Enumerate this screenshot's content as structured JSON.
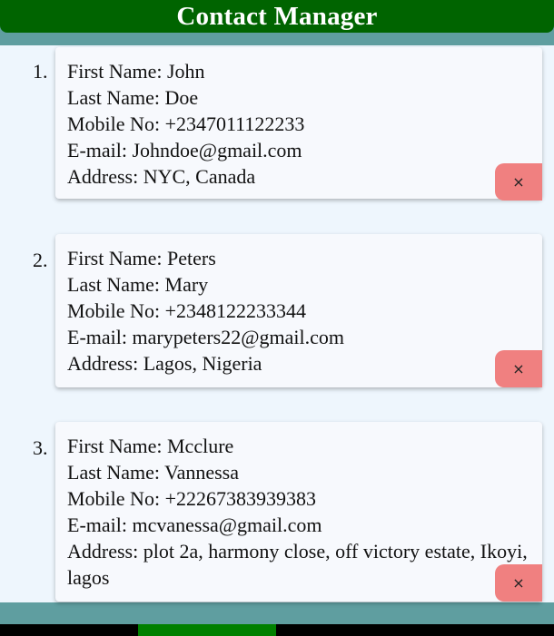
{
  "header": {
    "title": "Contact Manager"
  },
  "contacts": [
    {
      "number": "1.",
      "first_name_label": "First Name: ",
      "first_name": "John",
      "last_name_label": "Last Name: ",
      "last_name": "Doe",
      "mobile_label": "Mobile No: ",
      "mobile": "+2347011122233",
      "email_label": "E-mail: ",
      "email": "Johndoe@gmail.com",
      "address_label": "Address: ",
      "address": "NYC, Canada",
      "delete_label": "×"
    },
    {
      "number": "2.",
      "first_name_label": "First Name: ",
      "first_name": "Peters",
      "last_name_label": "Last Name: ",
      "last_name": "Mary",
      "mobile_label": "Mobile No: ",
      "mobile": "+2348122233344",
      "email_label": "E-mail: ",
      "email": "marypeters22@gmail.com",
      "address_label": "Address: ",
      "address": "Lagos, Nigeria",
      "delete_label": "×"
    },
    {
      "number": "3.",
      "first_name_label": "First Name: ",
      "first_name": "Mcclure",
      "last_name_label": "Last Name: ",
      "last_name": "Vannessa",
      "mobile_label": "Mobile No: ",
      "mobile": "+22267383939383",
      "email_label": "E-mail: ",
      "email": "mcvanessa@gmail.com",
      "address_label": "Address: ",
      "address": "plot 2a, harmony close, off victory estate, Ikoyi, lagos",
      "delete_label": "×"
    }
  ],
  "colors": {
    "header_bg": "#006400",
    "band": "#5f9ea0",
    "content_bg": "#eef6fd",
    "card_bg": "#f7f9fd",
    "delete_button": "#f08080",
    "footer_bar": "#000000",
    "footer_indicator": "#008000"
  },
  "icons": {
    "delete": "close-icon"
  }
}
